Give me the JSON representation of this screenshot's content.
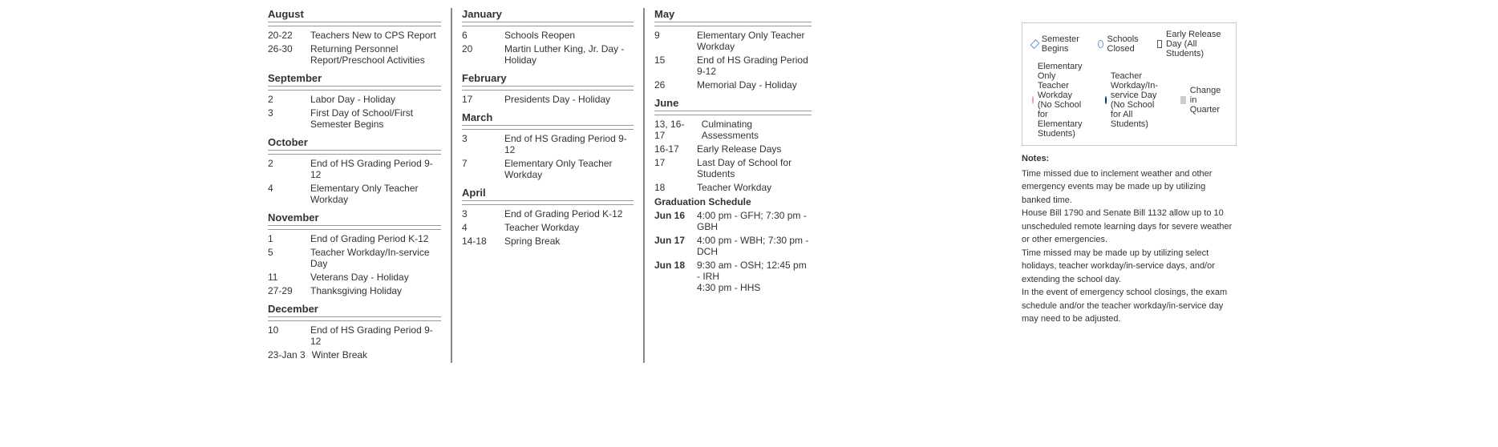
{
  "left_column": {
    "sections": [
      {
        "month": "August",
        "events": [
          {
            "date": "20-22",
            "desc": "Teachers New to CPS Report"
          },
          {
            "date": "26-30",
            "desc": "Returning Personnel Report/Preschool Activities"
          }
        ]
      },
      {
        "month": "September",
        "events": [
          {
            "date": "2",
            "desc": "Labor Day - Holiday"
          },
          {
            "date": "3",
            "desc": "First Day of School/First Semester Begins"
          }
        ]
      },
      {
        "month": "October",
        "events": [
          {
            "date": "2",
            "desc": "End of HS Grading Period 9-12"
          },
          {
            "date": "4",
            "desc": "Elementary Only Teacher Workday"
          }
        ]
      },
      {
        "month": "November",
        "events": [
          {
            "date": "1",
            "desc": "End of Grading Period K-12"
          },
          {
            "date": "5",
            "desc": "Teacher Workday/In-service Day"
          },
          {
            "date": "11",
            "desc": "Veterans Day - Holiday"
          },
          {
            "date": "27-29",
            "desc": "Thanksgiving Holiday"
          }
        ]
      },
      {
        "month": "December",
        "events": [
          {
            "date": "10",
            "desc": "End of HS Grading Period 9-12"
          },
          {
            "date": "23-Jan 3",
            "desc": "Winter Break"
          }
        ]
      }
    ]
  },
  "middle_column": {
    "sections": [
      {
        "month": "January",
        "events": [
          {
            "date": "6",
            "desc": "Schools Reopen"
          },
          {
            "date": "20",
            "desc": "Martin Luther King, Jr. Day - Holiday"
          }
        ]
      },
      {
        "month": "February",
        "events": [
          {
            "date": "17",
            "desc": "Presidents Day - Holiday"
          }
        ]
      },
      {
        "month": "March",
        "events": [
          {
            "date": "3",
            "desc": "End of HS Grading Period 9-12"
          },
          {
            "date": "7",
            "desc": "Elementary Only Teacher Workday"
          }
        ]
      },
      {
        "month": "April",
        "events": [
          {
            "date": "3",
            "desc": "End of Grading Period K-12"
          },
          {
            "date": "4",
            "desc": "Teacher Workday"
          },
          {
            "date": "14-18",
            "desc": "Spring Break"
          }
        ]
      }
    ]
  },
  "right_column": {
    "sections": [
      {
        "month": "May",
        "events": [
          {
            "date": "9",
            "desc": "Elementary Only Teacher Workday"
          },
          {
            "date": "15",
            "desc": "End of HS Grading Period 9-12"
          },
          {
            "date": "26",
            "desc": "Memorial Day - Holiday"
          }
        ]
      },
      {
        "month": "June",
        "events": [
          {
            "date": "13, 16-17",
            "desc": "Culminating Assessments"
          },
          {
            "date": "16-17",
            "desc": "Early Release Days"
          },
          {
            "date": "17",
            "desc": "Last Day of School for Students"
          },
          {
            "date": "18",
            "desc": "Teacher Workday"
          }
        ]
      }
    ],
    "graduation": {
      "header": "Graduation Schedule",
      "rows": [
        {
          "label": "Jun 16",
          "desc": "4:00 pm - GFH; 7:30 pm - GBH"
        },
        {
          "label": "Jun 17",
          "desc": "4:00 pm - WBH; 7:30 pm - DCH"
        },
        {
          "label": "Jun 18",
          "desc": "9:30 am - OSH; 12:45 pm - IRH\n4:30 pm - HHS"
        }
      ]
    }
  },
  "legend": {
    "items": [
      {
        "icon": "diamond",
        "text": "Semester Begins"
      },
      {
        "icon": "circle-outline",
        "text": "Schools Closed"
      },
      {
        "icon": "square-outline",
        "text": "Early Release Day (All Students)"
      },
      {
        "icon": "circle-pink",
        "text": "Elementary Only Teacher Workday (No School for Elementary Students)"
      },
      {
        "icon": "circle-darkblue",
        "text": "Teacher Workday/In-service Day (No School for All Students)"
      },
      {
        "icon": "rect-gray",
        "text": "Change in Quarter"
      }
    ]
  },
  "notes": {
    "title": "Notes:",
    "lines": [
      "Time missed due to inclement weather and other emergency events may be made up by utilizing banked time.",
      "House Bill 1790 and Senate Bill 1132 allow up to 10 unscheduled remote learning days for severe weather or other emergencies.",
      "Time missed may be made up by utilizing select holidays, teacher workday/in-service days, and/or extending the school day.",
      "In the event of emergency school closings, the exam schedule and/or the teacher workday/in-service day may need to be adjusted."
    ]
  }
}
